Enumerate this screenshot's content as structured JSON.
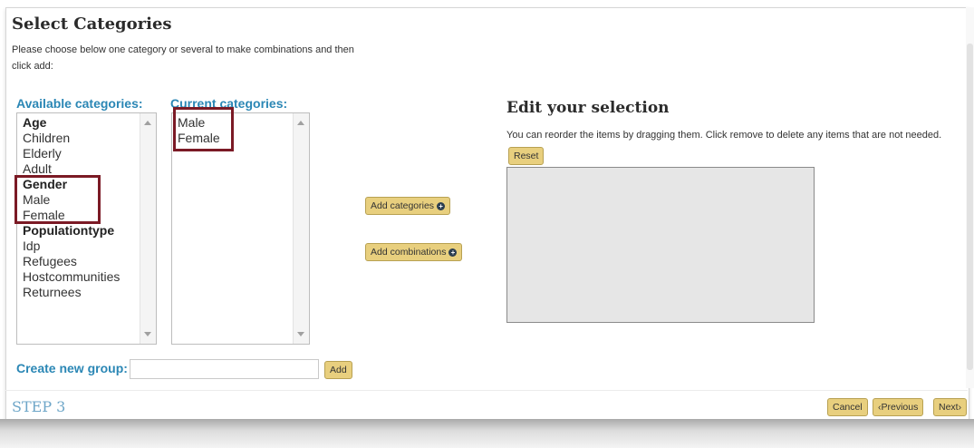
{
  "dialog": {
    "title": "Select Categories",
    "instructions": "Please choose below one category or several to make combinations and then click add:"
  },
  "available": {
    "heading": "Available categories:",
    "items": [
      {
        "label": "Age",
        "group": true
      },
      {
        "label": "Children",
        "group": false
      },
      {
        "label": "Elderly",
        "group": false
      },
      {
        "label": "Adult",
        "group": false
      },
      {
        "label": "Gender",
        "group": true
      },
      {
        "label": "Male",
        "group": false
      },
      {
        "label": "Female",
        "group": false
      },
      {
        "label": "Populationtype",
        "group": true
      },
      {
        "label": "Idp",
        "group": false
      },
      {
        "label": "Refugees",
        "group": false
      },
      {
        "label": "Hostcommunities",
        "group": false
      },
      {
        "label": "Returnees",
        "group": false
      }
    ]
  },
  "current": {
    "heading": "Current categories:",
    "items": [
      "Male",
      "Female"
    ]
  },
  "actions": {
    "add_categories": "Add categories",
    "add_combinations": "Add combinations"
  },
  "edit": {
    "title": "Edit your selection",
    "description": "You can reorder the items by dragging them. Click remove to delete any items that are not needed.",
    "reset_label": "Reset"
  },
  "create_group": {
    "label": "Create new group:",
    "value": "",
    "add_label": "Add"
  },
  "footer": {
    "step": "STEP 3",
    "cancel": "Cancel",
    "previous": "‹Previous",
    "next": "Next›"
  },
  "colors": {
    "accent": "#2b87b5",
    "button": "#e8cf7e",
    "highlight": "#7b1a25",
    "step": "#6ea6c8"
  }
}
